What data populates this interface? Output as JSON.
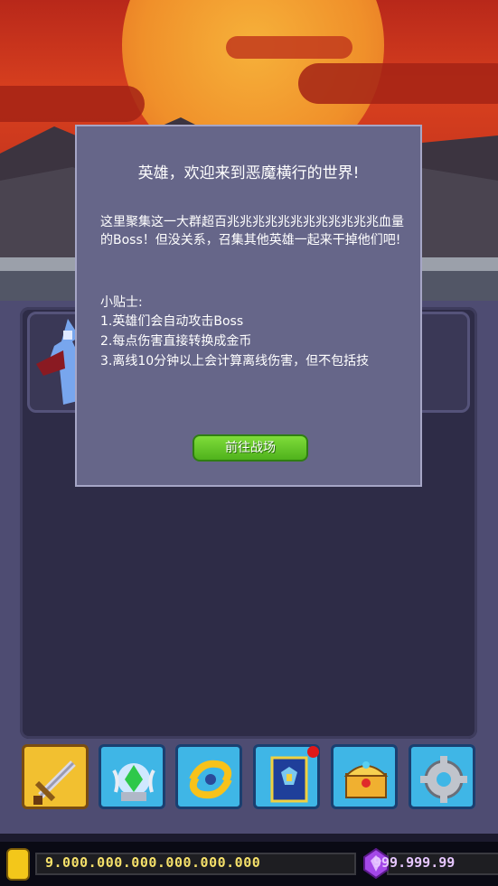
{
  "dialog": {
    "title": "英雄，欢迎来到恶魔横行的世界!",
    "intro": "这里聚集这一大群超百兆兆兆兆兆兆兆兆兆兆兆兆血量的Boss！但没关系，召集其他英雄一起来干掉他们吧!",
    "tips_title": "小贴士:",
    "tips": [
      "1.英雄们会自动攻击Boss",
      "2.每点伤害直接转换成金币",
      "3.离线10分钟以上会计算离线伤害，但不包括技"
    ],
    "go_button": "前往战场"
  },
  "toolbar": {
    "items": [
      {
        "icon": "sword-icon",
        "active": true
      },
      {
        "icon": "crystal-orb-icon",
        "active": false
      },
      {
        "icon": "swirl-icon",
        "active": false
      },
      {
        "icon": "spellbook-icon",
        "active": false,
        "badge": true
      },
      {
        "icon": "treasure-chest-icon",
        "active": false
      },
      {
        "icon": "gear-icon",
        "active": false
      }
    ]
  },
  "currency": {
    "gold": "9.000.000.000.000.000.000",
    "gems": "999.999.99"
  },
  "colors": {
    "dialog_bg": "#666689",
    "button_green": "#5fc22a",
    "toolbar_blue": "#3fb6e6",
    "toolbar_active": "#f2c030",
    "notification": "#e01818"
  }
}
